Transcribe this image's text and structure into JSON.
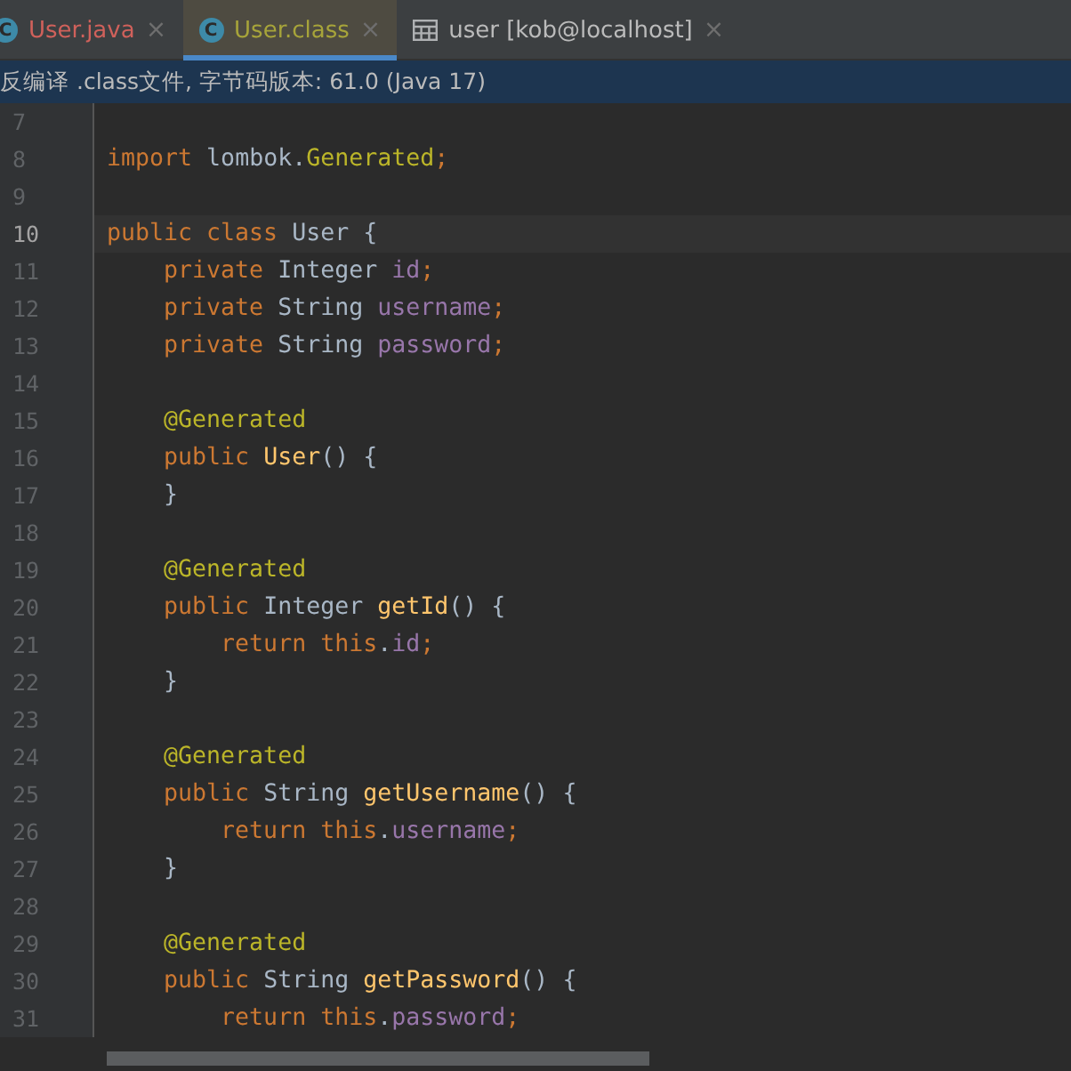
{
  "tabs": [
    {
      "label": "User.java",
      "icon": "C",
      "kind": "error",
      "selected": false,
      "close": "×"
    },
    {
      "label": "User.class",
      "icon": "C",
      "kind": "modified",
      "selected": true,
      "close": "×"
    },
    {
      "label": "user [kob@localhost]",
      "kind": "table",
      "selected": false,
      "close": "×"
    }
  ],
  "info_bar": {
    "text": "反编译 .class文件, 字节码版本: 61.0 (Java 17)"
  },
  "lines": [
    {
      "number": "7",
      "current": false
    },
    {
      "number": "8",
      "current": false,
      "tokens": [
        {
          "kind": "keyword",
          "text": "import"
        },
        {
          "kind": "plain",
          "text": " lombok."
        },
        {
          "kind": "annotation",
          "text": "Generated"
        },
        {
          "kind": "keyword",
          "text": ";"
        }
      ]
    },
    {
      "number": "9",
      "current": false
    },
    {
      "number": "10",
      "current": true,
      "tokens": [
        {
          "kind": "keyword",
          "text": "public class"
        },
        {
          "kind": "plain",
          "text": " User {"
        }
      ]
    },
    {
      "number": "11",
      "current": false,
      "tokens": [
        {
          "kind": "keyword",
          "text": "    private"
        },
        {
          "kind": "plain",
          "text": " Integer "
        },
        {
          "kind": "field",
          "text": "id"
        },
        {
          "kind": "keyword",
          "text": ";"
        }
      ]
    },
    {
      "number": "12",
      "current": false,
      "tokens": [
        {
          "kind": "keyword",
          "text": "    private"
        },
        {
          "kind": "plain",
          "text": " String "
        },
        {
          "kind": "field",
          "text": "username"
        },
        {
          "kind": "keyword",
          "text": ";"
        }
      ]
    },
    {
      "number": "13",
      "current": false,
      "tokens": [
        {
          "kind": "keyword",
          "text": "    private"
        },
        {
          "kind": "plain",
          "text": " String "
        },
        {
          "kind": "field",
          "text": "password"
        },
        {
          "kind": "keyword",
          "text": ";"
        }
      ]
    },
    {
      "number": "14",
      "current": false
    },
    {
      "number": "15",
      "current": false,
      "tokens": [
        {
          "kind": "annotation",
          "text": "    @Generated"
        }
      ]
    },
    {
      "number": "16",
      "current": false,
      "tokens": [
        {
          "kind": "keyword",
          "text": "    public "
        },
        {
          "kind": "method",
          "text": "User"
        },
        {
          "kind": "plain",
          "text": "() {"
        }
      ]
    },
    {
      "number": "17",
      "current": false,
      "tokens": [
        {
          "kind": "plain",
          "text": "    }"
        }
      ]
    },
    {
      "number": "18",
      "current": false
    },
    {
      "number": "19",
      "current": false,
      "tokens": [
        {
          "kind": "annotation",
          "text": "    @Generated"
        }
      ]
    },
    {
      "number": "20",
      "current": false,
      "tokens": [
        {
          "kind": "keyword",
          "text": "    public"
        },
        {
          "kind": "plain",
          "text": " Integer "
        },
        {
          "kind": "method",
          "text": "getId"
        },
        {
          "kind": "plain",
          "text": "() {"
        }
      ]
    },
    {
      "number": "21",
      "current": false,
      "tokens": [
        {
          "kind": "keyword",
          "text": "        return this"
        },
        {
          "kind": "plain",
          "text": "."
        },
        {
          "kind": "field",
          "text": "id"
        },
        {
          "kind": "keyword",
          "text": ";"
        }
      ]
    },
    {
      "number": "22",
      "current": false,
      "tokens": [
        {
          "kind": "plain",
          "text": "    }"
        }
      ]
    },
    {
      "number": "23",
      "current": false
    },
    {
      "number": "24",
      "current": false,
      "tokens": [
        {
          "kind": "annotation",
          "text": "    @Generated"
        }
      ]
    },
    {
      "number": "25",
      "current": false,
      "tokens": [
        {
          "kind": "keyword",
          "text": "    public"
        },
        {
          "kind": "plain",
          "text": " String "
        },
        {
          "kind": "method",
          "text": "getUsername"
        },
        {
          "kind": "plain",
          "text": "() {"
        }
      ]
    },
    {
      "number": "26",
      "current": false,
      "tokens": [
        {
          "kind": "keyword",
          "text": "        return this"
        },
        {
          "kind": "plain",
          "text": "."
        },
        {
          "kind": "field",
          "text": "username"
        },
        {
          "kind": "keyword",
          "text": ";"
        }
      ]
    },
    {
      "number": "27",
      "current": false,
      "tokens": [
        {
          "kind": "plain",
          "text": "    }"
        }
      ]
    },
    {
      "number": "28",
      "current": false
    },
    {
      "number": "29",
      "current": false,
      "tokens": [
        {
          "kind": "annotation",
          "text": "    @Generated"
        }
      ]
    },
    {
      "number": "30",
      "current": false,
      "tokens": [
        {
          "kind": "keyword",
          "text": "    public"
        },
        {
          "kind": "plain",
          "text": " String "
        },
        {
          "kind": "method",
          "text": "getPassword"
        },
        {
          "kind": "plain",
          "text": "() {"
        }
      ]
    },
    {
      "number": "31",
      "current": false,
      "tokens": [
        {
          "kind": "keyword",
          "text": "        return this"
        },
        {
          "kind": "plain",
          "text": "."
        },
        {
          "kind": "field",
          "text": "password"
        },
        {
          "kind": "keyword",
          "text": ";"
        }
      ]
    }
  ]
}
